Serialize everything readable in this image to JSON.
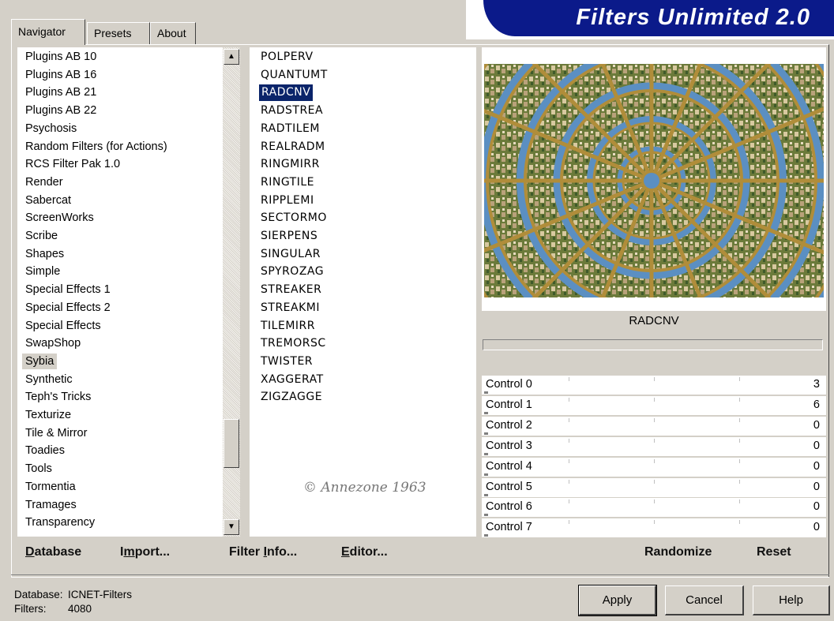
{
  "tabs": [
    {
      "label": "Navigator"
    },
    {
      "label": "Presets"
    },
    {
      "label": "About"
    }
  ],
  "app_title": "Filters Unlimited 2.0",
  "categories": [
    "Plugins AB 10",
    "Plugins AB 16",
    "Plugins AB 21",
    "Plugins AB 22",
    "Psychosis",
    "Random Filters (for Actions)",
    "RCS Filter Pak 1.0",
    "Render",
    "Sabercat",
    "ScreenWorks",
    "Scribe",
    "Shapes",
    "Simple",
    "Special Effects 1",
    "Special Effects 2",
    "Special Effects",
    "SwapShop",
    "Sybia",
    "Synthetic",
    "Teph's Tricks",
    "Texturize",
    "Tile & Mirror",
    "Toadies",
    "Tools",
    "Tormentia",
    "Tramages",
    "Transparency"
  ],
  "selected_category": "Sybia",
  "filters": [
    "POLPERV",
    "QUANTUMT",
    "RADCNV",
    "RADSTREA",
    "RADTILEM",
    "REALRADM",
    "RINGMIRR",
    "RINGTILE",
    "RIPPLEMI",
    "SECTORMO",
    "SIERPENS",
    "SINGULAR",
    "SPYROZAG",
    "STREAKER",
    "STREAKMI",
    "TILEMIRR",
    "TREMORSC",
    "TWISTER",
    "XAGGERAT",
    "ZIGZAGGE"
  ],
  "selected_filter": "RADCNV",
  "watermark": "© Annezone 1963",
  "preview": {
    "name": "RADCNV"
  },
  "controls": [
    {
      "label": "Control 0",
      "value": "3"
    },
    {
      "label": "Control 1",
      "value": "6"
    },
    {
      "label": "Control 2",
      "value": "0"
    },
    {
      "label": "Control 3",
      "value": "0"
    },
    {
      "label": "Control 4",
      "value": "0"
    },
    {
      "label": "Control 5",
      "value": "0"
    },
    {
      "label": "Control 6",
      "value": "0"
    },
    {
      "label": "Control 7",
      "value": "0"
    }
  ],
  "buttons": {
    "database": "Database",
    "import": "Import...",
    "filter_info": "Filter Info...",
    "editor": "Editor...",
    "randomize": "Randomize",
    "reset": "Reset",
    "apply": "Apply",
    "cancel": "Cancel",
    "help": "Help"
  },
  "status": {
    "database_label": "Database:",
    "database_value": "ICNET-Filters",
    "filters_label": "Filters:",
    "filters_value": "4080"
  },
  "colors": {
    "window_bg": "#d4d0c8",
    "banner": "#0b1a8a",
    "selection": "#0a246a"
  }
}
